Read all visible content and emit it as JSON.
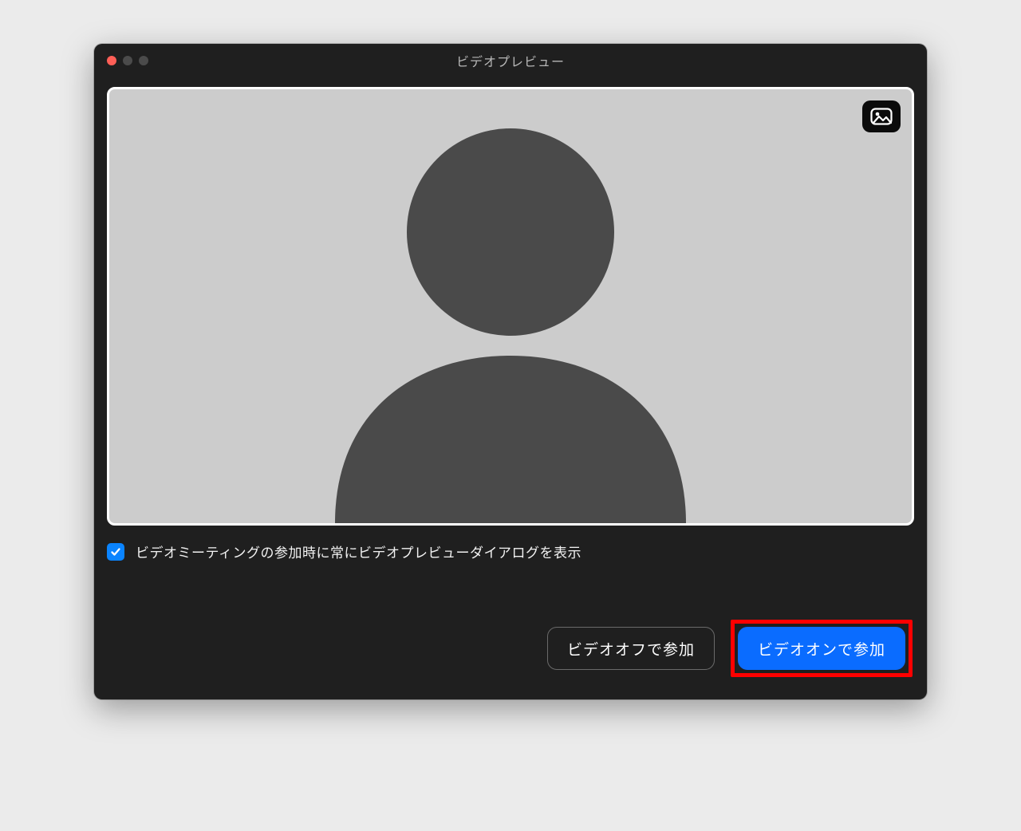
{
  "window": {
    "title": "ビデオプレビュー"
  },
  "checkbox": {
    "label": "ビデオミーティングの参加時に常にビデオプレビューダイアログを表示",
    "checked": true
  },
  "buttons": {
    "join_without_video": "ビデオオフで参加",
    "join_with_video": "ビデオオンで参加"
  }
}
